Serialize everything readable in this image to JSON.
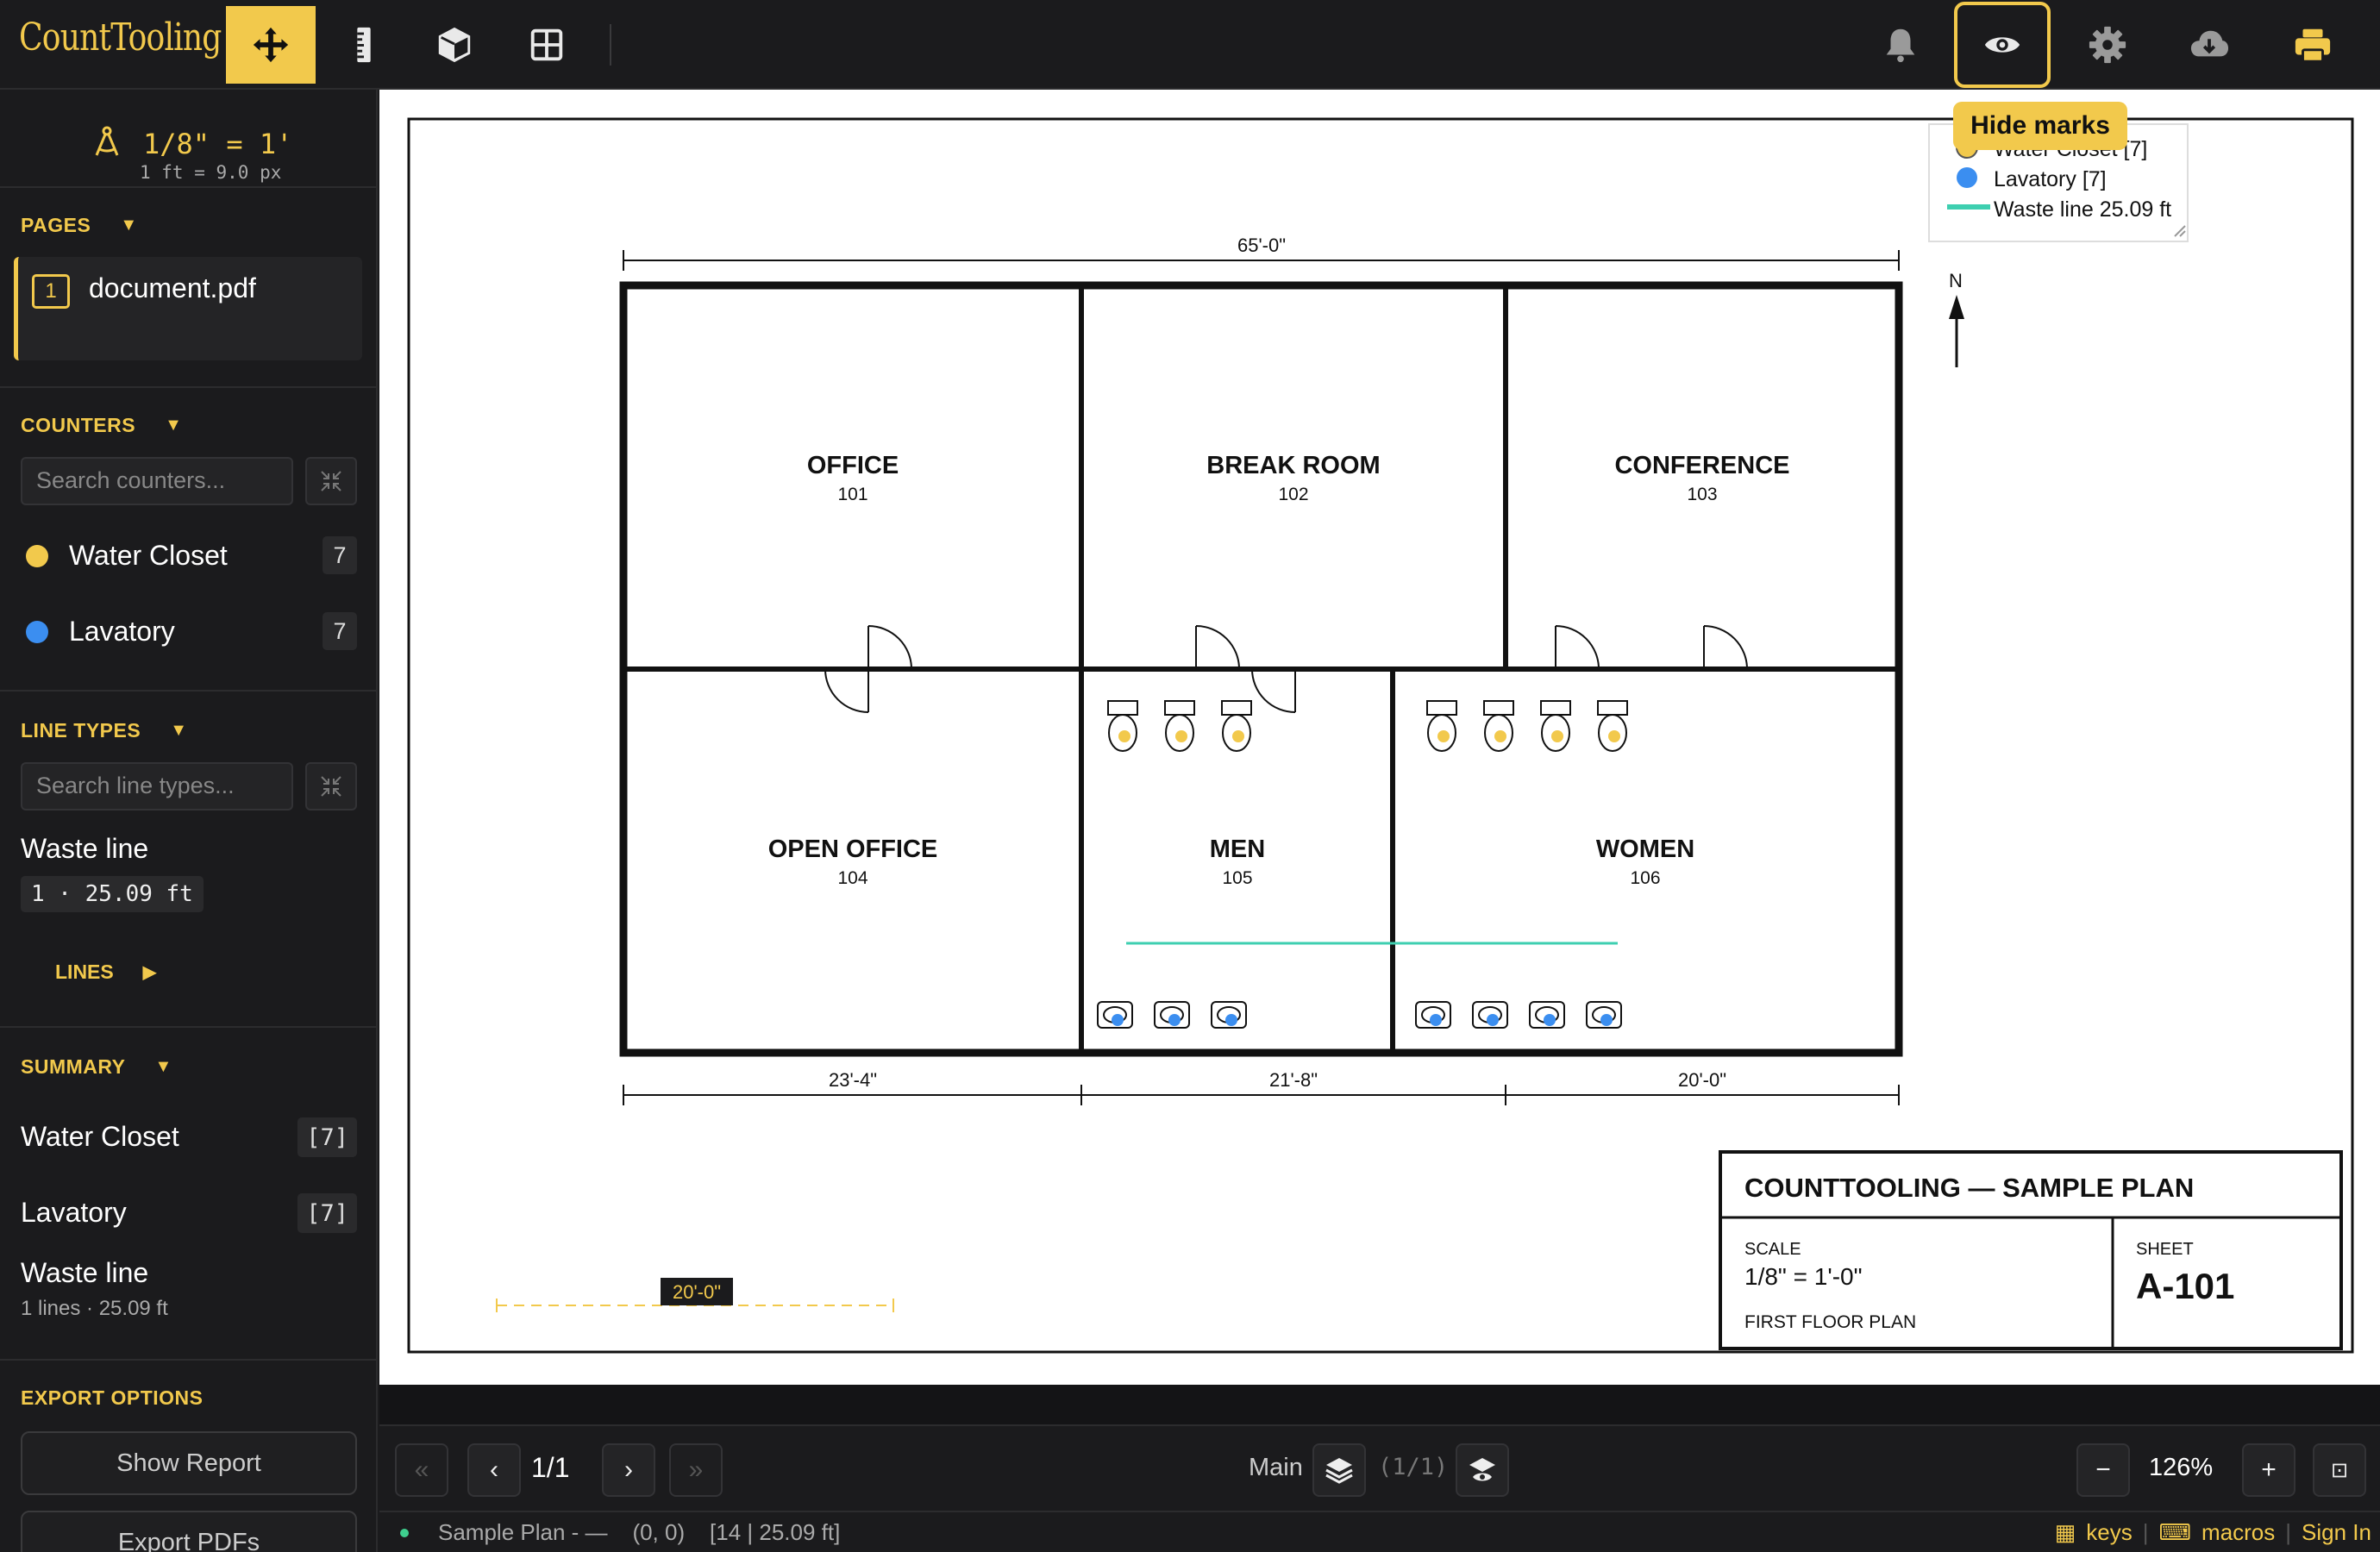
{
  "app": {
    "title": "CountTooling"
  },
  "toolbar": {
    "tools": [
      "move-icon",
      "measure-icon",
      "cube-icon",
      "grid-icon"
    ],
    "right": [
      "bell-icon",
      "eye-icon",
      "gear-icon",
      "cloud-download-icon",
      "print-icon"
    ],
    "tooltip": "Hide marks",
    "accent": "#f2c94c"
  },
  "scale": {
    "label": "1/8\" = 1'",
    "sub": "1 ft = 9.0 px"
  },
  "pages": {
    "heading": "PAGES",
    "items": [
      {
        "number": "1",
        "name": "document.pdf"
      }
    ]
  },
  "counters": {
    "heading": "COUNTERS",
    "search_placeholder": "Search counters...",
    "items": [
      {
        "name": "Water Closet",
        "count": "7",
        "color": "#f2c94c"
      },
      {
        "name": "Lavatory",
        "count": "7",
        "color": "#3b8ef0"
      }
    ]
  },
  "line_types": {
    "heading": "LINE TYPES",
    "search_placeholder": "Search line types...",
    "items": [
      {
        "name": "Waste line",
        "badge": "1 · 25.09 ft",
        "color": "#3ecfb0"
      }
    ],
    "lines_label": "LINES"
  },
  "summary": {
    "heading": "SUMMARY",
    "items": [
      {
        "name": "Water Closet",
        "badge": "[7]"
      },
      {
        "name": "Lavatory",
        "badge": "[7]"
      }
    ],
    "waste_name": "Waste line",
    "waste_sub": "1 lines · 25.09 ft"
  },
  "export": {
    "heading": "EXPORT OPTIONS",
    "show_report": "Show Report",
    "export_pdfs": "Export PDFs"
  },
  "plan": {
    "legend": {
      "water_closet": "Water Closet [7]",
      "lavatory": "Lavatory [7]",
      "waste": "Waste line 25.09 ft"
    },
    "overall_dim": "65'-0\"",
    "north": "N",
    "rooms": [
      {
        "name": "OFFICE",
        "number": "101"
      },
      {
        "name": "BREAK ROOM",
        "number": "102"
      },
      {
        "name": "CONFERENCE",
        "number": "103"
      },
      {
        "name": "OPEN OFFICE",
        "number": "104"
      },
      {
        "name": "MEN",
        "number": "105"
      },
      {
        "name": "WOMEN",
        "number": "106"
      }
    ],
    "bottom_dims": [
      "23'-4\"",
      "21'-8\"",
      "20'-0\""
    ],
    "measure_label": "20'-0\"",
    "title_block": {
      "title": "COUNTTOOLING — SAMPLE PLAN",
      "scale_label": "SCALE",
      "scale_value": "1/8\" = 1'-0\"",
      "drawing": "FIRST FLOOR PLAN",
      "sheet_label": "SHEET",
      "sheet_value": "A-101"
    }
  },
  "nav": {
    "page_indicator": "1/1",
    "layer_label": "Main",
    "layer_count": "(1/1)",
    "zoom": "126%"
  },
  "status": {
    "plan": "Sample Plan - —",
    "coords": "(0, 0)",
    "info": "[14 | 25.09 ft]",
    "keys": "keys",
    "macros": "macros",
    "sign_in": "Sign In"
  }
}
